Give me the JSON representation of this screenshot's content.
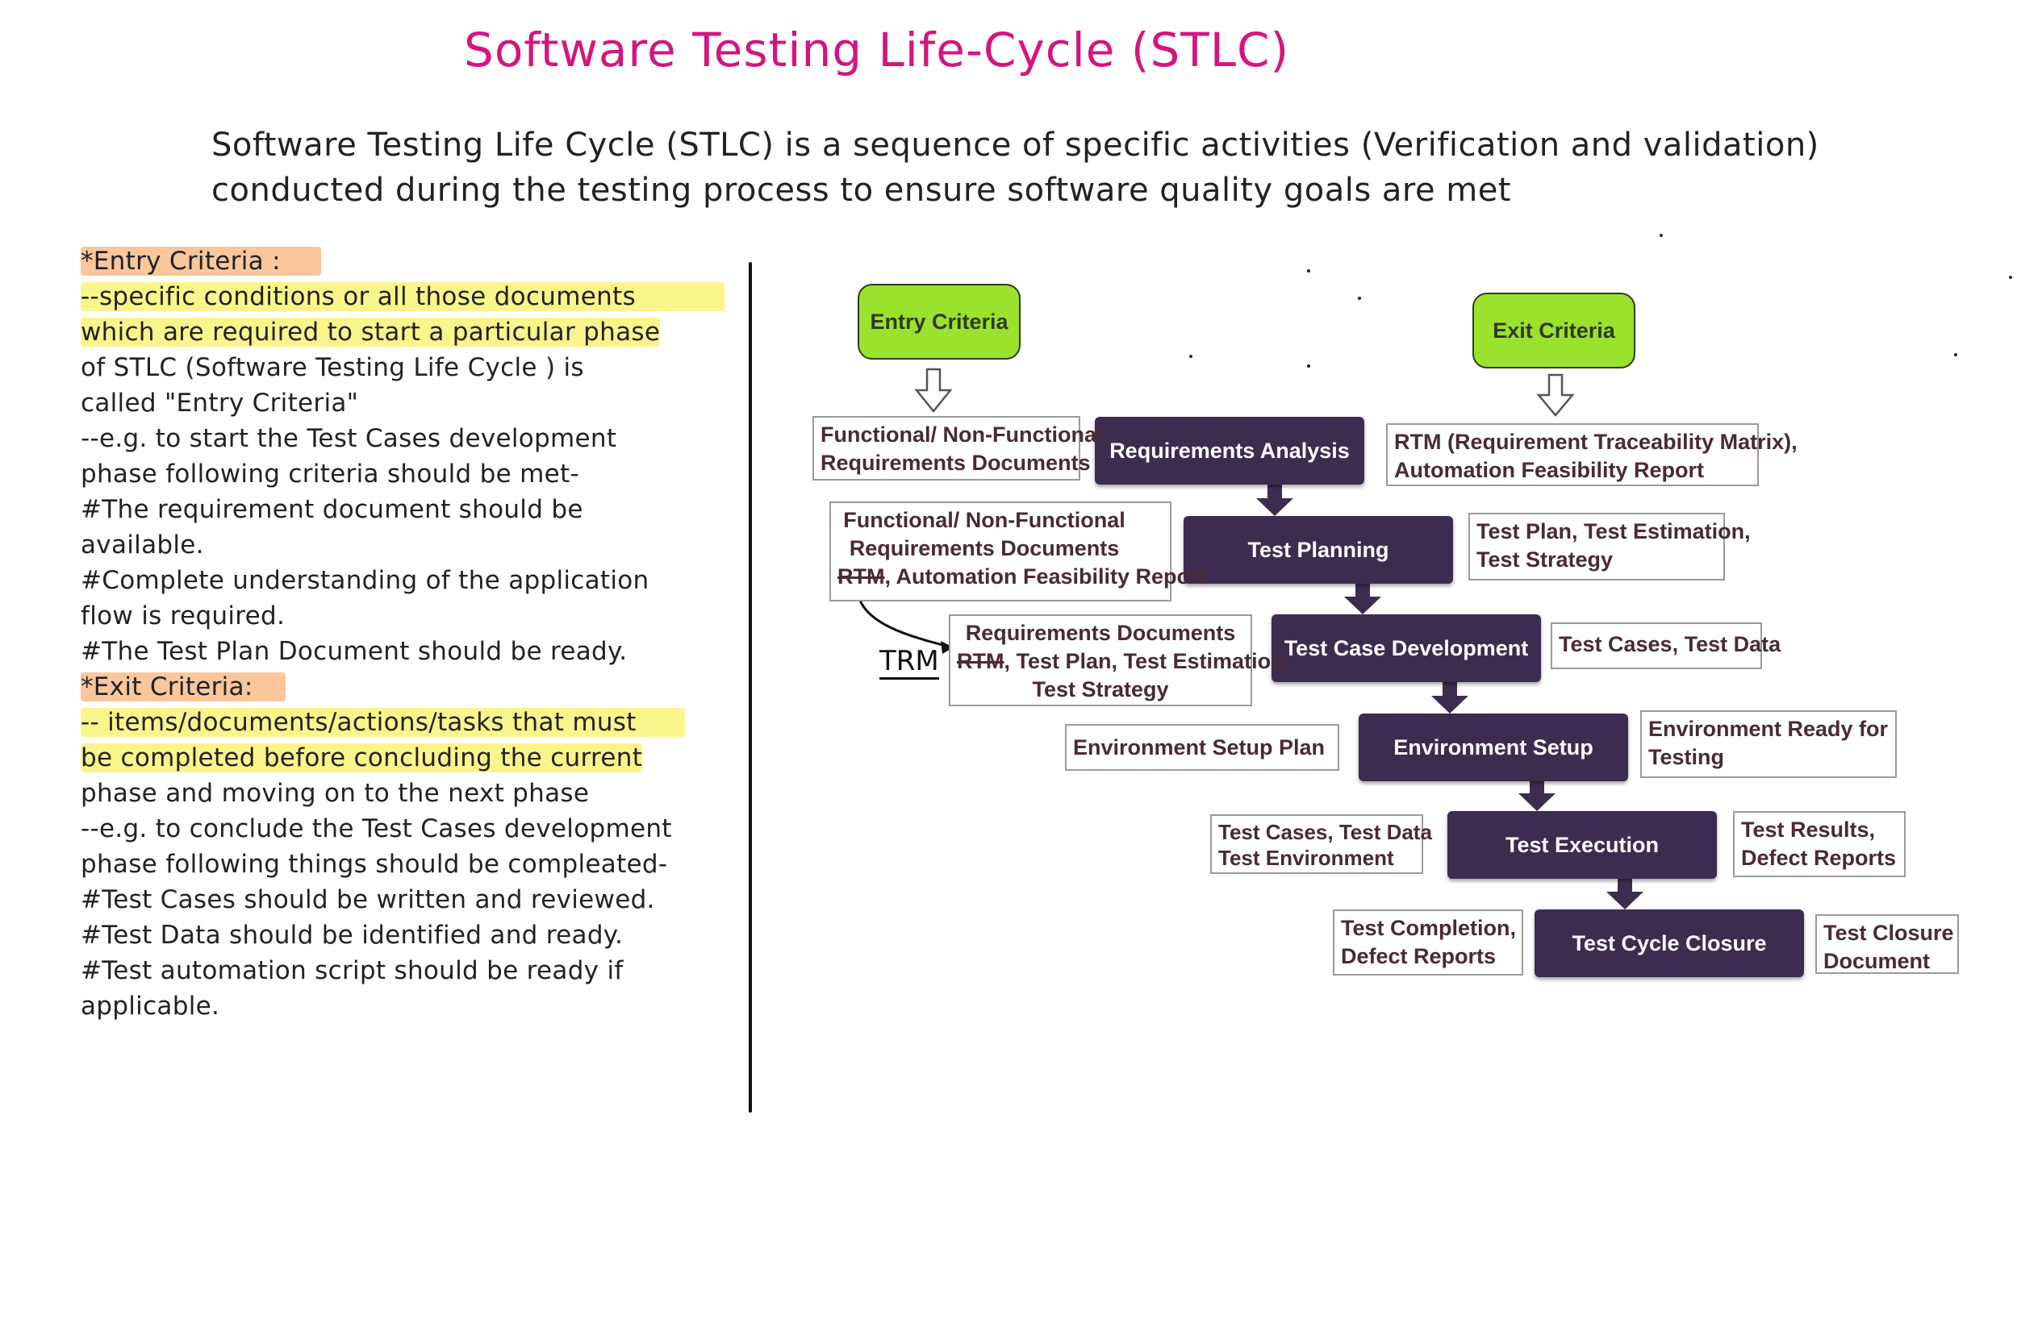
{
  "title": "Software Testing Life-Cycle (STLC)",
  "intro": "Software Testing Life Cycle (STLC) is a sequence of specific activities (Verification and validation) conducted during the testing process to ensure software quality goals are met",
  "notes": {
    "entry_heading": "*Entry Criteria :",
    "entry_lines": [
      "--specific conditions or all those documents",
      "which are required to start a particular phase",
      "of STLC (Software Testing Life Cycle ) is",
      "called \"Entry Criteria\"",
      "--e.g. to start the Test Cases development",
      "phase following criteria should be met-",
      "#The requirement document should be",
      "available.",
      "#Complete understanding of the application",
      "flow is required.",
      "#The Test Plan Document should be ready."
    ],
    "exit_heading": "*Exit Criteria:",
    "exit_lines": [
      "-- items/documents/actions/tasks that must",
      "be completed before concluding the current",
      "phase and moving on to the next phase",
      "--e.g. to conclude the Test Cases development",
      "phase following things should be compleated-",
      "#Test Cases should be written and reviewed.",
      "#Test Data should be identified and ready.",
      "#Test automation script should be ready if",
      "applicable."
    ]
  },
  "diagram": {
    "entry_criteria": "Entry Criteria",
    "exit_criteria": "Exit Criteria",
    "phases": [
      "Requirements Analysis",
      "Test Planning",
      "Test Case Development",
      "Environment Setup",
      "Test Execution",
      "Test Cycle Closure"
    ],
    "inputs": {
      "req_analysis": [
        "Functional/ Non-Functional",
        "Requirements Documents"
      ],
      "test_planning": [
        "Functional/ Non-Functional",
        "Requirements Documents",
        "RTM",
        ", Automation Feasibility Report"
      ],
      "test_case_dev": [
        "Requirements Documents",
        "RTM",
        ", Test Plan, Test Estimation,",
        "Test Strategy"
      ],
      "env_setup": [
        "Environment Setup Plan"
      ],
      "test_execution": [
        "Test Cases, Test Data",
        "Test Environment"
      ],
      "closure": [
        "Test Completion,",
        "Defect Reports"
      ]
    },
    "outputs": {
      "req_analysis": [
        "RTM (Requirement Traceability Matrix),",
        "Automation Feasibility Report"
      ],
      "test_planning": [
        "Test Plan, Test Estimation,",
        "Test Strategy"
      ],
      "test_case_dev": [
        "Test Cases, Test Data"
      ],
      "env_setup": [
        "Environment Ready for",
        "Testing"
      ],
      "test_execution": [
        "Test Results,",
        "Defect Reports"
      ],
      "closure": [
        "Test Closure",
        "Document"
      ]
    },
    "annotation": "TRM"
  },
  "colors": {
    "title": "#d4157e",
    "phase_fill": "#3c2c50",
    "criteria_fill": "#9be22e",
    "highlight_orange": "#f9c79b",
    "highlight_yellow": "#faf58a",
    "box_text": "#4a2a34"
  }
}
